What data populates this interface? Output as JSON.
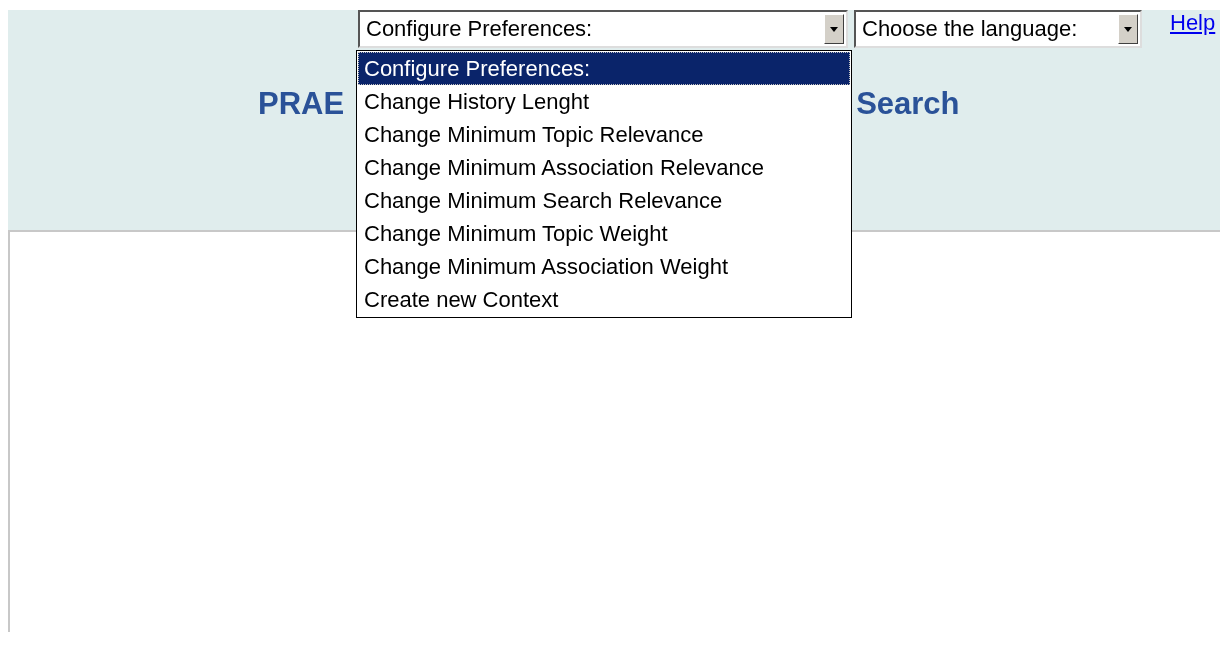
{
  "preferences_select": {
    "value": "Configure Preferences:",
    "expanded": true,
    "options": [
      {
        "label": "Configure Preferences:",
        "selected": true
      },
      {
        "label": "Change History Lenght",
        "selected": false
      },
      {
        "label": "Change Minimum Topic Relevance",
        "selected": false
      },
      {
        "label": "Change Minimum Association Relevance",
        "selected": false
      },
      {
        "label": "Change Minimum Search Relevance",
        "selected": false
      },
      {
        "label": "Change Minimum Topic Weight",
        "selected": false
      },
      {
        "label": "Change Minimum Association Weight",
        "selected": false
      },
      {
        "label": "Create new Context",
        "selected": false
      }
    ]
  },
  "language_select": {
    "value": "Choose the language:"
  },
  "help_link": "Help",
  "title_fragments": [
    "PRAE",
    "Search"
  ]
}
